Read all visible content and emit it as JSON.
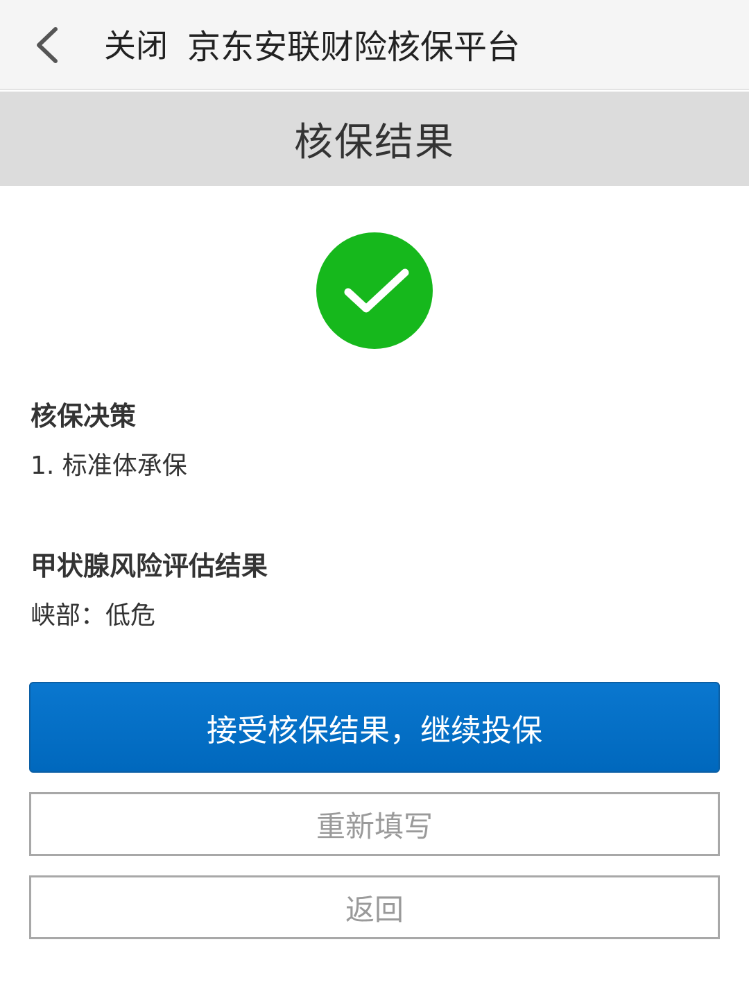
{
  "topbar": {
    "back_icon": "chevron-left-icon",
    "close_label": "关闭",
    "title": "京东安联财险核保平台"
  },
  "subheader": {
    "title": "核保结果"
  },
  "result": {
    "status_icon": "check-circle-icon",
    "status_color": "#16b81c"
  },
  "decision": {
    "title": "核保决策",
    "items": [
      "1. 标准体承保"
    ]
  },
  "thyroid": {
    "title": "甲状腺风险评估结果",
    "value": "峡部：低危"
  },
  "actions": {
    "accept_label": "接受核保结果，继续投保",
    "refill_label": "重新填写",
    "return_label": "返回",
    "primary_color": "#0a72c8"
  }
}
